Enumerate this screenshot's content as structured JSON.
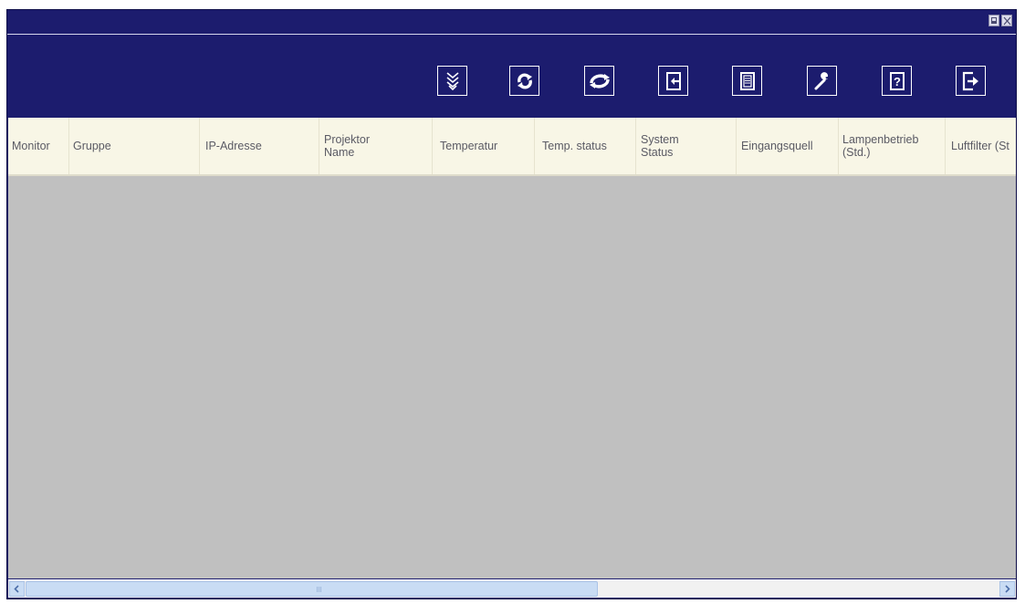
{
  "window": {
    "title": ""
  },
  "toolbar": {
    "buttons": [
      {
        "icon": "chevron-down-double-icon"
      },
      {
        "icon": "refresh-icon"
      },
      {
        "icon": "refresh-all-icon"
      },
      {
        "icon": "import-icon"
      },
      {
        "icon": "document-icon"
      },
      {
        "icon": "wrench-icon"
      },
      {
        "icon": "help-icon"
      },
      {
        "icon": "exit-icon"
      }
    ]
  },
  "table": {
    "columns": [
      {
        "line1": "Monitor",
        "line2": ""
      },
      {
        "line1": "Gruppe",
        "line2": ""
      },
      {
        "line1": "IP-Adresse",
        "line2": ""
      },
      {
        "line1": "Projektor",
        "line2": "Name"
      },
      {
        "line1": "Temperatur",
        "line2": ""
      },
      {
        "line1": "Temp. status",
        "line2": ""
      },
      {
        "line1": "System",
        "line2": "Status"
      },
      {
        "line1": "Eingangsquell",
        "line2": ""
      },
      {
        "line1": "Lampenbetrieb",
        "line2": "(Std.)"
      },
      {
        "line1": "Luftfilter (St",
        "line2": ""
      }
    ],
    "rows": []
  },
  "colors": {
    "window_bg": "#1c1c6e",
    "header_bg": "#f8f6e6",
    "body_bg": "#c0c0c0",
    "scrollbar_thumb": "#c9dcf4"
  }
}
